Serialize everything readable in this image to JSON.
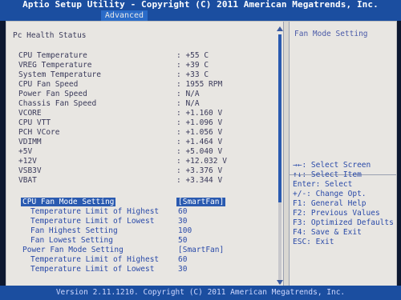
{
  "app": {
    "title": "Aptio Setup Utility - Copyright (C) 2011 American Megatrends, Inc.",
    "tab": "Advanced"
  },
  "section": {
    "header": "Pc Health Status"
  },
  "readings": [
    {
      "label": "CPU Temperature",
      "value": ": +55 C"
    },
    {
      "label": "VREG Temperature",
      "value": ": +39 C"
    },
    {
      "label": "System Temperature",
      "value": ": +33 C"
    },
    {
      "label": "CPU Fan Speed",
      "value": ": 1955 RPM"
    },
    {
      "label": "Power Fan Speed",
      "value": ": N/A"
    },
    {
      "label": "Chassis Fan Speed",
      "value": ": N/A"
    },
    {
      "label": "VCORE",
      "value": ": +1.160 V"
    },
    {
      "label": "CPU VTT",
      "value": ": +1.096 V"
    },
    {
      "label": "PCH VCore",
      "value": ": +1.056 V"
    },
    {
      "label": "VDIMM",
      "value": ": +1.464 V"
    },
    {
      "label": "+5V",
      "value": ": +5.040 V"
    },
    {
      "label": "+12V",
      "value": ": +12.032 V"
    },
    {
      "label": "VSB3V",
      "value": ": +3.376 V"
    },
    {
      "label": "VBAT",
      "value": ": +3.344 V"
    }
  ],
  "settings": [
    {
      "label": "CPU Fan Mode Setting",
      "value": "[SmartFan]"
    },
    {
      "label": "Temperature Limit of Highest",
      "value": "60"
    },
    {
      "label": "Temperature Limit of Lowest",
      "value": "30"
    },
    {
      "label": "Fan Highest Setting",
      "value": "100"
    },
    {
      "label": "Fan Lowest Setting",
      "value": "50"
    },
    {
      "label": "Power Fan Mode Setting",
      "value": "[SmartFan]"
    },
    {
      "label": "Temperature Limit of Highest",
      "value": "60"
    },
    {
      "label": "Temperature Limit of Lowest",
      "value": "30"
    }
  ],
  "help": {
    "title": "Fan Mode Setting",
    "keys": [
      "→←: Select Screen",
      "↑↓: Select Item",
      "Enter: Select",
      "+/-: Change Opt.",
      "F1: General Help",
      "F2: Previous Values",
      "F3: Optimized Defaults",
      "F4: Save & Exit",
      "ESC: Exit"
    ]
  },
  "footer": {
    "version": "Version 2.11.1210. Copyright (C) 2011 American Megatrends, Inc."
  },
  "colors": {
    "header_blue": "#1b4ea0",
    "panel": "#e8e6e2",
    "highlight": "#2a5ab0"
  }
}
